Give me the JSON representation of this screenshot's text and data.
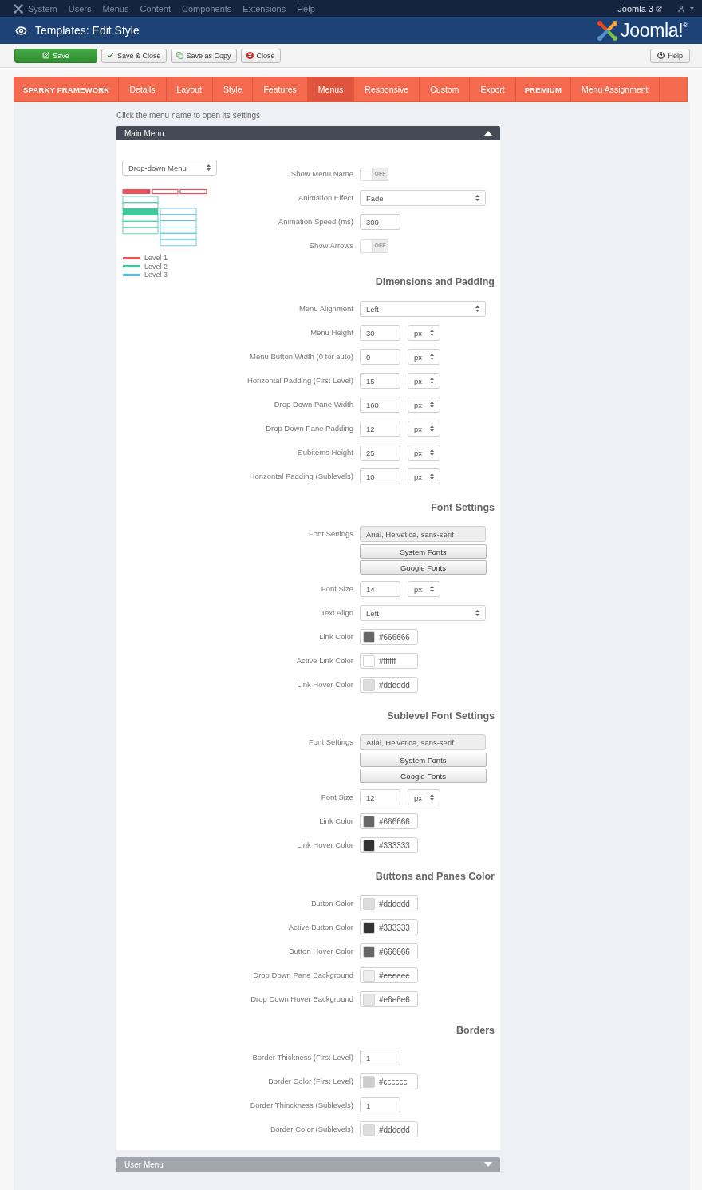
{
  "admin_menu": {
    "items": [
      "System",
      "Users",
      "Menus",
      "Content",
      "Components",
      "Extensions",
      "Help"
    ],
    "site_link": "Joomla 3"
  },
  "header": {
    "title": "Templates: Edit Style",
    "logo_text": "Joomla!$^{®}$"
  },
  "toolbar": {
    "buttons": [
      {
        "label": "Save",
        "kind": "primary"
      },
      {
        "label": "Save & Close",
        "kind": "default"
      },
      {
        "label": "Save as Copy",
        "kind": "default"
      },
      {
        "label": "Close",
        "kind": "default"
      }
    ],
    "help": "Help"
  },
  "tabs": [
    {
      "label": "SPARKY FRAMEWORK",
      "kind": "bold",
      "selected": false
    },
    {
      "label": "Details",
      "kind": "plain",
      "selected": false
    },
    {
      "label": "Layout",
      "kind": "plain",
      "selected": false
    },
    {
      "label": "Style",
      "kind": "plain",
      "selected": false
    },
    {
      "label": "Features",
      "kind": "plain",
      "selected": false
    },
    {
      "label": "Menus",
      "kind": "plain",
      "selected": true
    },
    {
      "label": "Responsive",
      "kind": "plain",
      "selected": false
    },
    {
      "label": "Custom",
      "kind": "plain",
      "selected": false
    },
    {
      "label": "Export",
      "kind": "plain",
      "selected": false
    },
    {
      "label": "PREMIUM",
      "kind": "bold",
      "selected": false
    },
    {
      "label": "Menu Assignment",
      "kind": "plain",
      "selected": false
    }
  ],
  "hint": "Click the menu name to open its settings",
  "menus": [
    {
      "name": "Main Menu",
      "expanded": true,
      "menu_type": "Drop-down Menu",
      "legend": [
        {
          "label": "Level 1",
          "color": "#f0505c"
        },
        {
          "label": "Level 2",
          "color": "#3fc89a"
        },
        {
          "label": "Level 3",
          "color": "#4cc2ea"
        }
      ],
      "sections": [
        {
          "rows": [
            {
              "label": "Show Menu Name",
              "kind": "toggle",
              "on": false,
              "text": "OFF"
            },
            {
              "label": "Animation Effect",
              "kind": "select",
              "value": "Fade"
            },
            {
              "label": "Animation Speed (ms)",
              "kind": "input",
              "value": "300"
            },
            {
              "label": "Show Arrows",
              "kind": "toggle",
              "on": false,
              "text": "OFF"
            }
          ]
        },
        {
          "heading": "Dimensions and Padding",
          "rows": [
            {
              "label": "Menu Alignment",
              "kind": "select",
              "value": "Left"
            },
            {
              "label": "Menu Height",
              "kind": "size",
              "value": "30",
              "unit": "px"
            },
            {
              "label": "Menu Button Width (0 for auto)",
              "kind": "size",
              "value": "0",
              "unit": "px"
            },
            {
              "label": "Horizontal Padding (First Level)",
              "kind": "size",
              "value": "15",
              "unit": "px"
            },
            {
              "label": "Drop Down Pane Width",
              "kind": "size",
              "value": "160",
              "unit": "px"
            },
            {
              "label": "Drop Down Pane Padding",
              "kind": "size",
              "value": "12",
              "unit": "px"
            },
            {
              "label": "Subitems Height",
              "kind": "size",
              "value": "25",
              "unit": "px"
            },
            {
              "label": "Horizontal Padding (Sublevels)",
              "kind": "size",
              "value": "10",
              "unit": "px"
            }
          ]
        },
        {
          "heading": "Font Settings",
          "rows": [
            {
              "label": "Font Settings",
              "kind": "font",
              "value": "Arial, Helvetica, sans-serif",
              "disabled": true,
              "buttons": [
                "System Fonts",
                "Google Fonts"
              ]
            },
            {
              "label": "Font Size",
              "kind": "size",
              "value": "14",
              "unit": "px"
            },
            {
              "label": "Text Align",
              "kind": "select",
              "value": "Left"
            },
            {
              "label": "Link Color",
              "kind": "color",
              "value": "#666666",
              "color": "#666666"
            },
            {
              "label": "Active Link Color",
              "kind": "color",
              "value": "#ffffff",
              "color": "#ffffff"
            },
            {
              "label": "Link Hover Color",
              "kind": "color",
              "value": "#dddddd",
              "color": "#dddddd"
            }
          ]
        },
        {
          "heading": "Sublevel Font Settings",
          "rows": [
            {
              "label": "Font Settings",
              "kind": "font",
              "value": "Arial, Helvetica, sans-serif",
              "disabled": true,
              "buttons": [
                "System Fonts",
                "Google Fonts"
              ]
            },
            {
              "label": "Font Size",
              "kind": "size",
              "value": "12",
              "unit": "px"
            },
            {
              "label": "Link Color",
              "kind": "color",
              "value": "#666666",
              "color": "#666666"
            },
            {
              "label": "Link Hover Color",
              "kind": "color",
              "value": "#333333",
              "color": "#333333"
            }
          ]
        },
        {
          "heading": "Buttons and Panes Color",
          "rows": [
            {
              "label": "Button Color",
              "kind": "color",
              "value": "#dddddd",
              "color": "#dddddd"
            },
            {
              "label": "Active Button Color",
              "kind": "color",
              "value": "#333333",
              "color": "#333333"
            },
            {
              "label": "Button Hover Color",
              "kind": "color",
              "value": "#666666",
              "color": "#666666"
            },
            {
              "label": "Drop Down Pane Background",
              "kind": "color",
              "value": "#eeeeee",
              "color": "#eeeeee"
            },
            {
              "label": "Drop Down Hover Background",
              "kind": "color",
              "value": "#e6e6e6",
              "color": "#e6e6e6"
            }
          ]
        },
        {
          "heading": "Borders",
          "rows": [
            {
              "label": "Border Thickness (First Level)",
              "kind": "input",
              "value": "1"
            },
            {
              "label": "Border Color (First Level)",
              "kind": "color",
              "value": "#cccccc",
              "color": "#cccccc"
            },
            {
              "label": "Border Thinckness (Sublevels)",
              "kind": "input",
              "value": "1"
            },
            {
              "label": "Border Color (Sublevels)",
              "kind": "color",
              "value": "#dddddd",
              "color": "#dddddd"
            }
          ]
        }
      ]
    },
    {
      "name": "User Menu",
      "expanded": false
    }
  ]
}
